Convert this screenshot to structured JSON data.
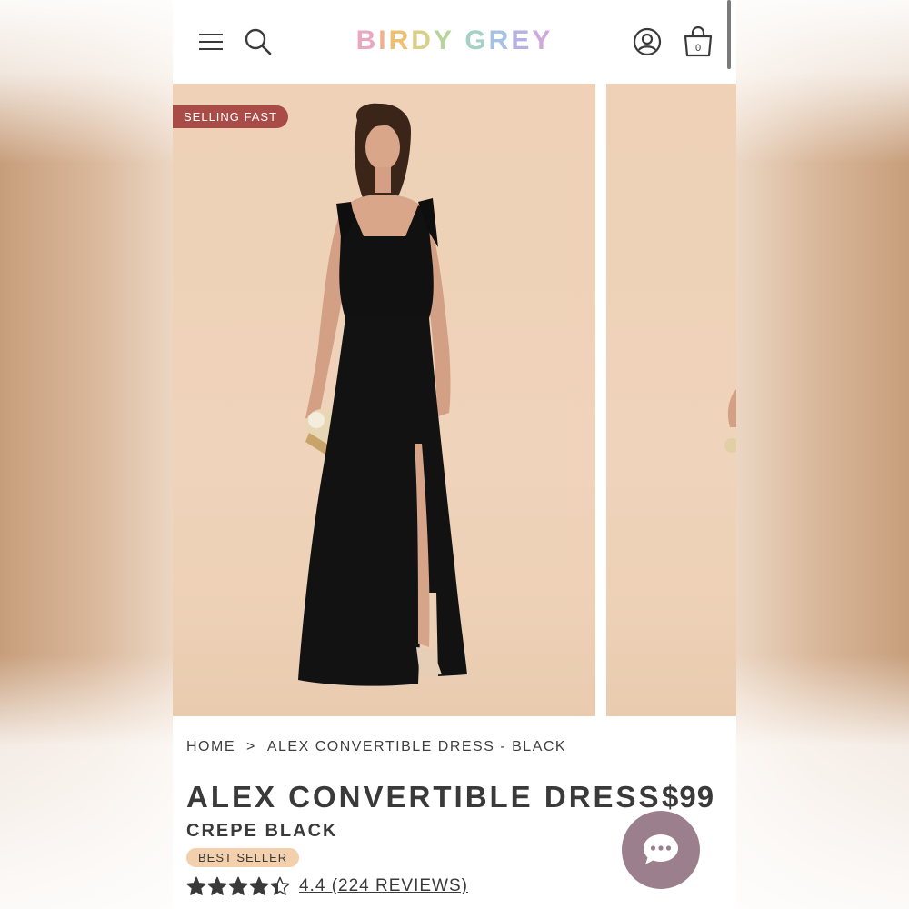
{
  "header": {
    "logo_letters": [
      {
        "char": "B",
        "color": "#e8a8c0"
      },
      {
        "char": "I",
        "color": "#f2b08a"
      },
      {
        "char": "R",
        "color": "#eec070"
      },
      {
        "char": "D",
        "color": "#d9cf86"
      },
      {
        "char": "Y",
        "color": "#b8d49a"
      },
      {
        "char": " ",
        "color": "#ffffff"
      },
      {
        "char": "G",
        "color": "#a6d1c6"
      },
      {
        "char": "R",
        "color": "#a7c1e3"
      },
      {
        "char": "E",
        "color": "#b6b0e3"
      },
      {
        "char": "Y",
        "color": "#cfa8dc"
      }
    ],
    "cart_count": "0",
    "icons": [
      "menu-icon",
      "search-icon",
      "account-icon",
      "shopping-bag-icon"
    ]
  },
  "gallery": {
    "badge": "SELLING FAST",
    "badge_color": "#a94c47",
    "backdrop_color": "#eed1b6",
    "dress_color": "#111111"
  },
  "breadcrumb": {
    "home": "HOME",
    "separator": ">",
    "current": "ALEX CONVERTIBLE DRESS - BLACK"
  },
  "product": {
    "title": "ALEX CONVERTIBLE DRESS",
    "price": "$99",
    "color_name": "CREPE BLACK",
    "badge": "BEST SELLER",
    "rating_value": 4.4,
    "rating_max": 5,
    "reviews_text": "4.4 (224 REVIEWS)"
  },
  "chat": {
    "icon": "chat-bubble-icon",
    "color": "#9b7f8c"
  }
}
